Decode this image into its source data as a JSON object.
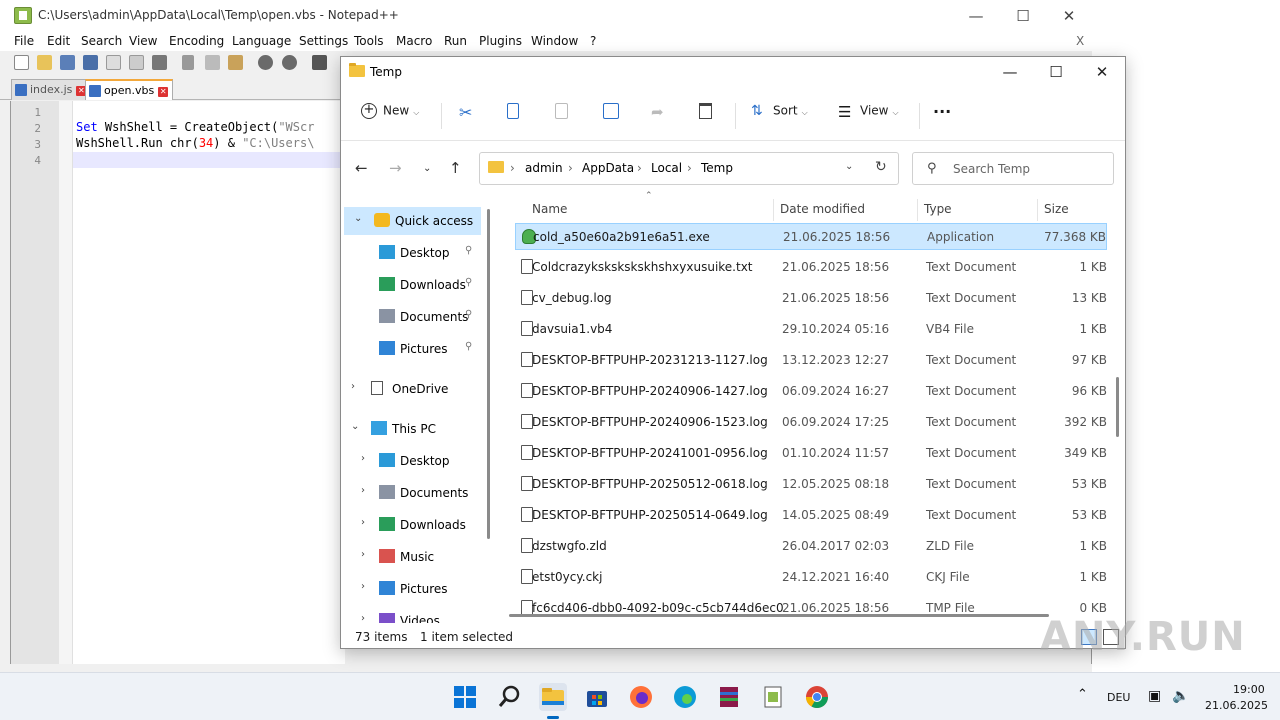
{
  "notepad": {
    "title": "C:\\Users\\admin\\AppData\\Local\\Temp\\open.vbs - Notepad++",
    "menu": [
      "File",
      "Edit",
      "Search",
      "View",
      "Encoding",
      "Language",
      "Settings",
      "Tools",
      "Macro",
      "Run",
      "Plugins",
      "Window",
      "?"
    ],
    "close_doc": "X",
    "tabs": [
      {
        "label": "index.js",
        "active": false
      },
      {
        "label": "open.vbs",
        "active": true
      }
    ],
    "line_numbers": [
      "1",
      "2",
      "3",
      "4"
    ],
    "code": {
      "line2_kw": "Set",
      "line2_rest": " WshShell = CreateObject(",
      "line2_str": "\"WScr",
      "line3_a": "WshShell.Run chr(",
      "line3_num": "34",
      "line3_b": ") & ",
      "line3_str": "\"C:\\Users\\"
    }
  },
  "explorer": {
    "title": "Temp",
    "commands": {
      "new": "New",
      "sort": "Sort",
      "view": "View",
      "more": "···"
    },
    "breadcrumb": [
      "admin",
      "AppData",
      "Local",
      "Temp"
    ],
    "search_placeholder": "Search Temp",
    "columns": {
      "name": "Name",
      "date": "Date modified",
      "type": "Type",
      "size": "Size"
    },
    "sidebar": [
      {
        "label": "Quick access",
        "icon": "star-icon",
        "selected": true
      },
      {
        "label": "Desktop",
        "icon": "desktop-icon",
        "pinned": true
      },
      {
        "label": "Downloads",
        "icon": "download-icon",
        "pinned": true
      },
      {
        "label": "Documents",
        "icon": "documents-icon",
        "pinned": true
      },
      {
        "label": "Pictures",
        "icon": "pictures-icon",
        "pinned": true
      },
      {
        "label": "OneDrive",
        "icon": "onedrive-icon"
      },
      {
        "label": "This PC",
        "icon": "pc-icon"
      },
      {
        "label": "Desktop",
        "icon": "desktop-icon"
      },
      {
        "label": "Documents",
        "icon": "documents-icon"
      },
      {
        "label": "Downloads",
        "icon": "download-icon"
      },
      {
        "label": "Music",
        "icon": "music-icon"
      },
      {
        "label": "Pictures",
        "icon": "pictures-icon"
      },
      {
        "label": "Videos",
        "icon": "videos-icon"
      }
    ],
    "files": [
      {
        "name": "cold_a50e60a2b91e6a51.exe",
        "date": "21.06.2025 18:56",
        "type": "Application",
        "size": "77.368 KB",
        "selected": true
      },
      {
        "name": "Coldcrazykskskskskhshxyxusuike.txt",
        "date": "21.06.2025 18:56",
        "type": "Text Document",
        "size": "1 KB"
      },
      {
        "name": "cv_debug.log",
        "date": "21.06.2025 18:56",
        "type": "Text Document",
        "size": "13 KB"
      },
      {
        "name": "davsuia1.vb4",
        "date": "29.10.2024 05:16",
        "type": "VB4 File",
        "size": "1 KB"
      },
      {
        "name": "DESKTOP-BFTPUHP-20231213-1127.log",
        "date": "13.12.2023 12:27",
        "type": "Text Document",
        "size": "97 KB"
      },
      {
        "name": "DESKTOP-BFTPUHP-20240906-1427.log",
        "date": "06.09.2024 16:27",
        "type": "Text Document",
        "size": "96 KB"
      },
      {
        "name": "DESKTOP-BFTPUHP-20240906-1523.log",
        "date": "06.09.2024 17:25",
        "type": "Text Document",
        "size": "392 KB"
      },
      {
        "name": "DESKTOP-BFTPUHP-20241001-0956.log",
        "date": "01.10.2024 11:57",
        "type": "Text Document",
        "size": "349 KB"
      },
      {
        "name": "DESKTOP-BFTPUHP-20250512-0618.log",
        "date": "12.05.2025 08:18",
        "type": "Text Document",
        "size": "53 KB"
      },
      {
        "name": "DESKTOP-BFTPUHP-20250514-0649.log",
        "date": "14.05.2025 08:49",
        "type": "Text Document",
        "size": "53 KB"
      },
      {
        "name": "dzstwgfo.zld",
        "date": "26.04.2017 02:03",
        "type": "ZLD File",
        "size": "1 KB"
      },
      {
        "name": "etst0ycy.ckj",
        "date": "24.12.2021 16:40",
        "type": "CKJ File",
        "size": "1 KB"
      },
      {
        "name": "fc6cd406-dbb0-4092-b09c-c5cb744d6ec0",
        "date": "21.06.2025 18:56",
        "type": "TMP File",
        "size": "0 KB"
      }
    ],
    "status": {
      "count": "73 items",
      "selection": "1 item selected"
    }
  },
  "taskbar": {
    "apps": [
      "start-icon",
      "search-icon",
      "file-explorer-icon",
      "store-icon",
      "firefox-icon",
      "edge-icon",
      "winrar-icon",
      "notepadpp-icon",
      "chrome-icon"
    ],
    "lang": "DEU",
    "time": "19:00",
    "date": "21.06.2025"
  },
  "watermark": "ANY.RUN"
}
